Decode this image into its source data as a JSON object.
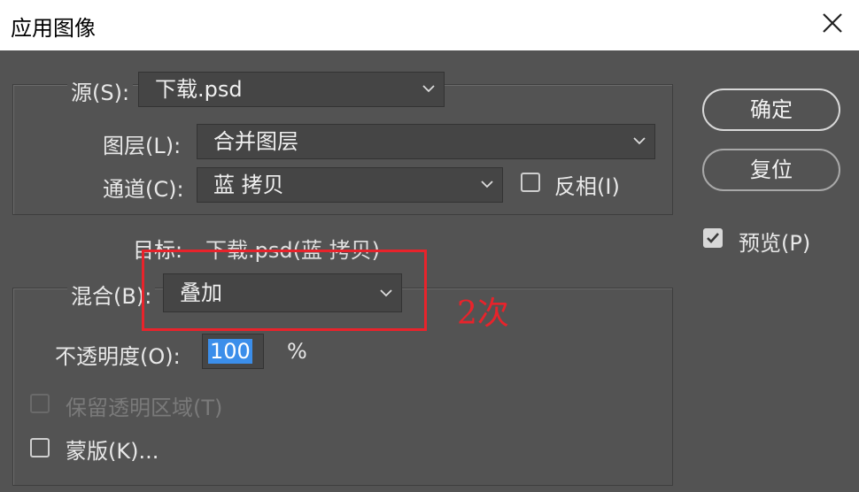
{
  "window": {
    "title": "应用图像"
  },
  "source": {
    "label": "源(S):",
    "value": "下载.psd",
    "layer_label": "图层(L):",
    "layer_value": "合并图层",
    "channel_label": "通道(C):",
    "channel_value": "蓝 拷贝",
    "invert_label": "反相(I)",
    "invert_checked": false
  },
  "target": {
    "label": "目标:",
    "value": "下载.psd(蓝 拷贝)"
  },
  "blending": {
    "label": "混合(B):",
    "value": "叠加",
    "opacity_label": "不透明度(O):",
    "opacity_value": "100",
    "opacity_unit": "%",
    "preserve_label": "保留透明区域(T)",
    "mask_label": "蒙版(K)..."
  },
  "buttons": {
    "ok": "确定",
    "reset": "复位"
  },
  "preview": {
    "label": "预览(P)",
    "checked": true
  },
  "annotation": {
    "text": "2次",
    "color": "#e8232b"
  },
  "icons": [
    "close-icon",
    "chevron-down-icon",
    "checkbox-icon",
    "checkmark-icon"
  ]
}
